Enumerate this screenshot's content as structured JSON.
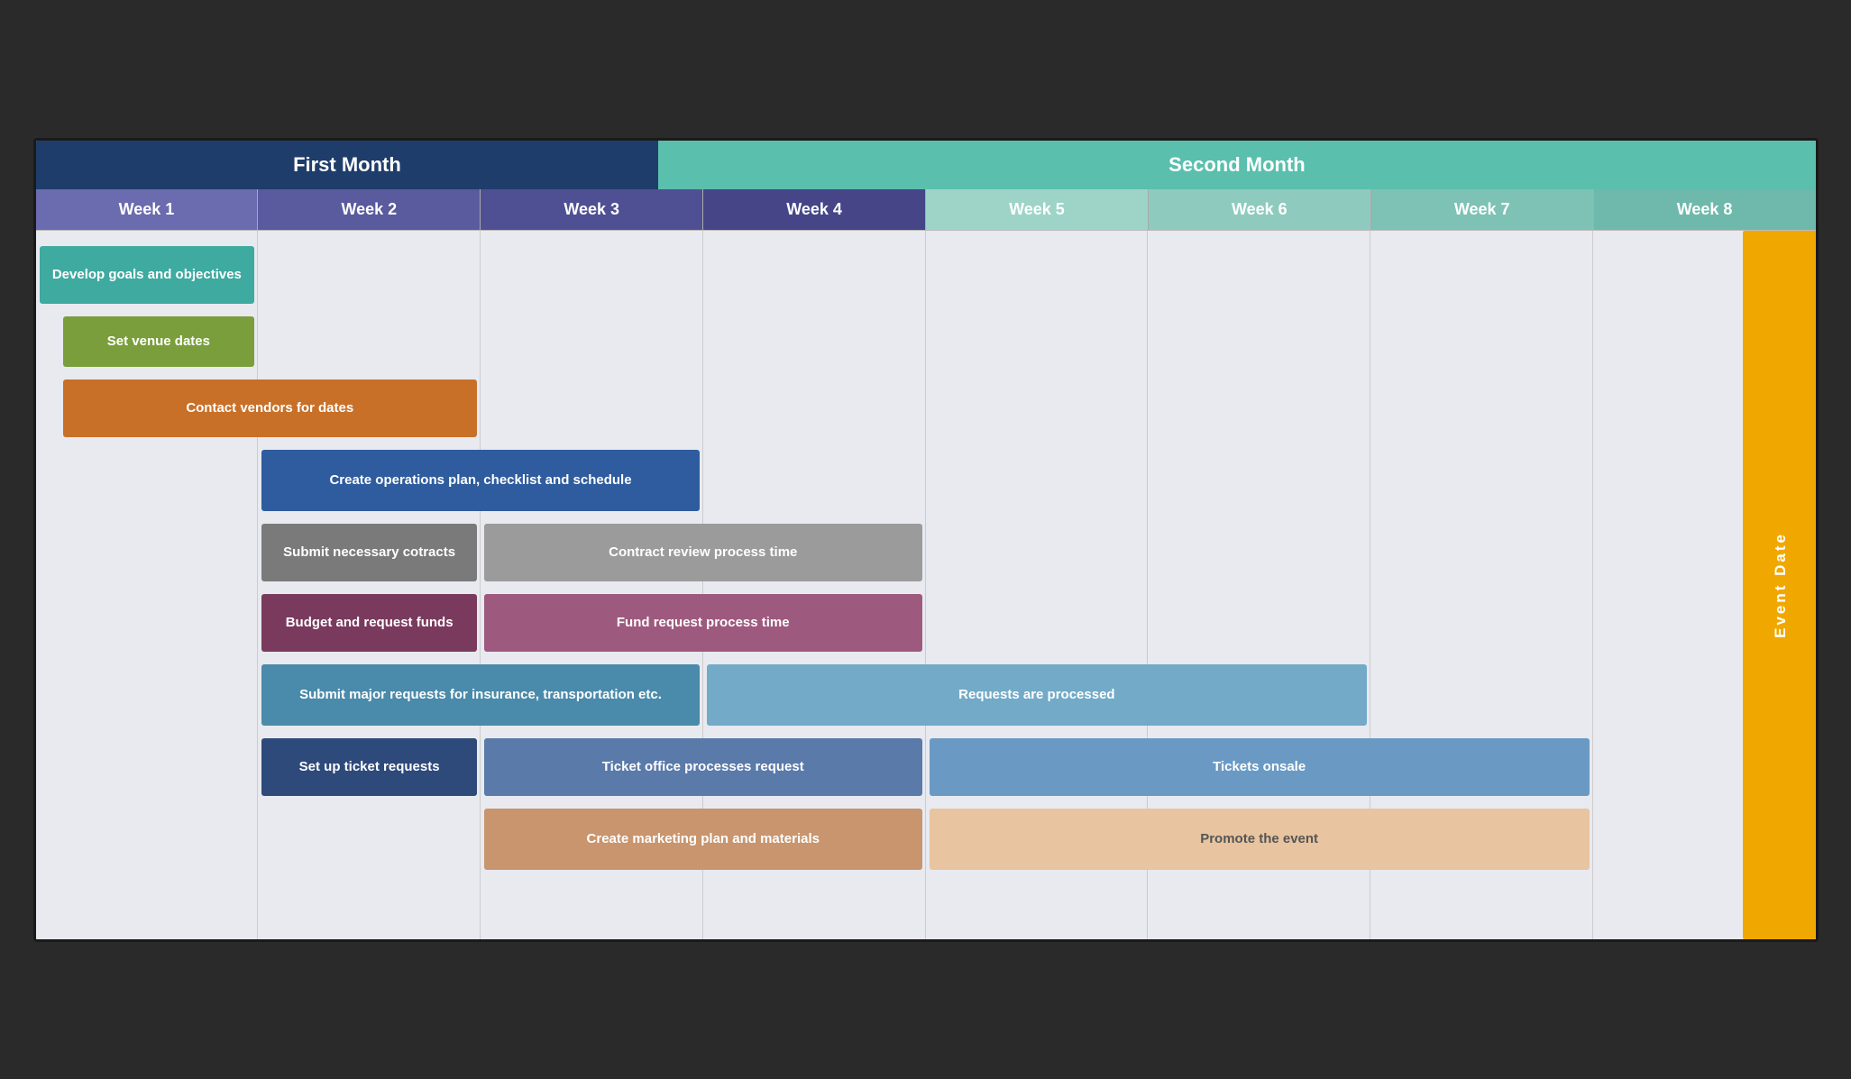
{
  "months": {
    "first": "First Month",
    "second": "Second Month"
  },
  "weeks": [
    {
      "label": "Week 1",
      "class": "w1"
    },
    {
      "label": "Week 2",
      "class": "w2"
    },
    {
      "label": "Week 3",
      "class": "w3"
    },
    {
      "label": "Week 4",
      "class": "w4"
    },
    {
      "label": "Week 5",
      "class": "w5"
    },
    {
      "label": "Week 6",
      "class": "w6"
    },
    {
      "label": "Week 7",
      "class": "w7"
    },
    {
      "label": "Week 8",
      "class": "w8"
    }
  ],
  "tasks": [
    {
      "id": "develop-goals",
      "label": "Develop goals and objectives",
      "color": "bg-teal",
      "colStart": 1,
      "colSpan": 1
    },
    {
      "id": "set-venue",
      "label": "Set venue dates",
      "color": "bg-olive",
      "colStart": 1,
      "colSpan": 1
    },
    {
      "id": "contact-vendors",
      "label": "Contact vendors for dates",
      "color": "bg-orange",
      "colStart": 1,
      "colSpan": 2
    },
    {
      "id": "operations-plan",
      "label": "Create operations plan, checklist and schedule",
      "color": "bg-navy",
      "colStart": 2,
      "colSpan": 2
    },
    {
      "id": "submit-contracts",
      "label": "Submit necessary cotracts",
      "color": "bg-gray",
      "colStart": 2,
      "colSpan": 1
    },
    {
      "id": "contract-review",
      "label": "Contract review process time",
      "color": "bg-gray-light",
      "colStart": 3,
      "colSpan": 2
    },
    {
      "id": "budget-funds",
      "label": "Budget and request funds",
      "color": "bg-maroon",
      "colStart": 2,
      "colSpan": 1
    },
    {
      "id": "fund-request",
      "label": "Fund request process time",
      "color": "bg-maroon-light",
      "colStart": 3,
      "colSpan": 2
    },
    {
      "id": "submit-major",
      "label": "Submit major requests for insurance, transportation etc.",
      "color": "bg-steel",
      "colStart": 2,
      "colSpan": 2
    },
    {
      "id": "requests-processed",
      "label": "Requests are processed",
      "color": "bg-steel-light",
      "colStart": 4,
      "colSpan": 3
    },
    {
      "id": "ticket-requests",
      "label": "Set up ticket requests",
      "color": "bg-blue-dark",
      "colStart": 2,
      "colSpan": 1
    },
    {
      "id": "ticket-office",
      "label": "Ticket office processes request",
      "color": "bg-blue-mid",
      "colStart": 3,
      "colSpan": 2
    },
    {
      "id": "tickets-onsale",
      "label": "Tickets onsale",
      "color": "bg-blue-light",
      "colStart": 5,
      "colSpan": 3
    },
    {
      "id": "marketing-plan",
      "label": "Create marketing plan and materials",
      "color": "bg-peach",
      "colStart": 3,
      "colSpan": 2
    },
    {
      "id": "promote-event",
      "label": "Promote the event",
      "color": "bg-peach-light",
      "colStart": 5,
      "colSpan": 3
    }
  ],
  "event_date_label": "Event Date"
}
